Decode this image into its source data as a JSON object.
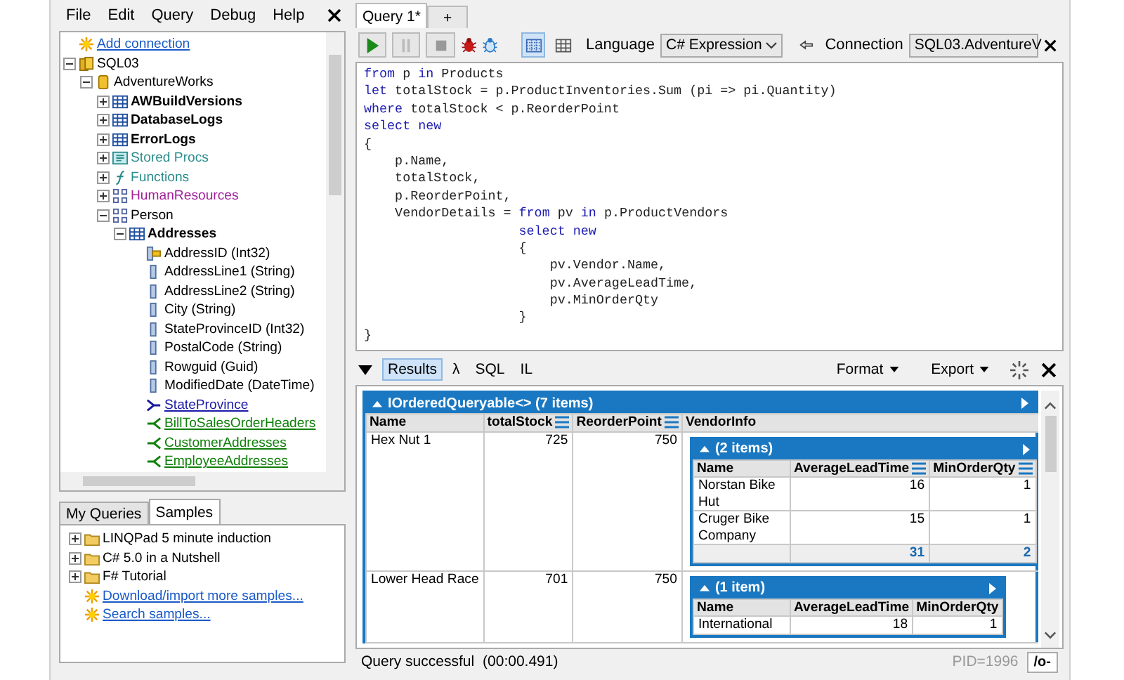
{
  "menu": [
    "File",
    "Edit",
    "Query",
    "Debug",
    "Help"
  ],
  "schema_tree": [
    {
      "kind": "add",
      "label": "Add connection"
    },
    {
      "kind": "server",
      "label": "SQL03",
      "expanded": true,
      "children": [
        {
          "kind": "database",
          "label": "AdventureWorks",
          "expanded": true,
          "children": [
            {
              "kind": "table",
              "label": "AWBuildVersions",
              "expanded": false
            },
            {
              "kind": "table",
              "label": "DatabaseLogs",
              "expanded": false
            },
            {
              "kind": "table",
              "label": "ErrorLogs",
              "expanded": false
            },
            {
              "kind": "sp",
              "label": "Stored Procs",
              "expanded": false,
              "color": "#2a8c8c"
            },
            {
              "kind": "fx",
              "label": "Functions",
              "expanded": false,
              "color": "#2a8c8c"
            },
            {
              "kind": "schema",
              "label": "HumanResources",
              "expanded": false,
              "color": "#a0209a"
            },
            {
              "kind": "schema",
              "label": "Person",
              "expanded": true,
              "children": [
                {
                  "kind": "table",
                  "label": "Addresses",
                  "expanded": true,
                  "children": [
                    {
                      "kind": "key-column",
                      "label": "AddressID (Int32)"
                    },
                    {
                      "kind": "column",
                      "label": "AddressLine1 (String)"
                    },
                    {
                      "kind": "column",
                      "label": "AddressLine2 (String)"
                    },
                    {
                      "kind": "column",
                      "label": "City (String)"
                    },
                    {
                      "kind": "column",
                      "label": "StateProvinceID (Int32)"
                    },
                    {
                      "kind": "column",
                      "label": "PostalCode (String)"
                    },
                    {
                      "kind": "column",
                      "label": "Rowguid (Guid)"
                    },
                    {
                      "kind": "column",
                      "label": "ModifiedDate (DateTime)"
                    },
                    {
                      "kind": "parent-rel",
                      "label": "StateProvince"
                    },
                    {
                      "kind": "child-rel",
                      "label": "BillToSalesOrderHeaders"
                    },
                    {
                      "kind": "child-rel",
                      "label": "CustomerAddresses"
                    },
                    {
                      "kind": "child-rel",
                      "label": "EmployeeAddresses"
                    }
                  ]
                }
              ]
            }
          ]
        }
      ]
    }
  ],
  "explorer_tabs": [
    {
      "label": "My Queries",
      "selected": false
    },
    {
      "label": "Samples",
      "selected": true
    }
  ],
  "samples_tree": [
    {
      "kind": "folder",
      "label": "LINQPad 5 minute induction",
      "expanded": false
    },
    {
      "kind": "folder",
      "label": "C# 5.0 in a Nutshell",
      "expanded": false
    },
    {
      "kind": "folder",
      "label": "F# Tutorial",
      "expanded": false
    },
    {
      "kind": "add",
      "label": "Download/import more samples..."
    },
    {
      "kind": "add",
      "label": "Search samples..."
    }
  ],
  "query_tabs": [
    {
      "label": "Query 1*",
      "selected": true
    },
    {
      "label": "+",
      "selected": false
    }
  ],
  "toolbar": {
    "view_modes": [
      {
        "kind": "rich",
        "selected": true
      },
      {
        "kind": "grid",
        "selected": false
      }
    ],
    "language": {
      "label": "Language",
      "value": "C# Expression"
    },
    "connection": {
      "label": "Connection",
      "value": "SQL03.AdventureV"
    }
  },
  "code_lines": [
    [
      {
        "kind": "keyword",
        "text": "from"
      },
      {
        "kind": "plain",
        "text": " p "
      },
      {
        "kind": "keyword",
        "text": "in"
      },
      {
        "kind": "plain",
        "text": " Products"
      }
    ],
    [
      {
        "kind": "keyword",
        "text": "let"
      },
      {
        "kind": "plain",
        "text": " totalStock = p.ProductInventories.Sum (pi => pi.Quantity)"
      }
    ],
    [
      {
        "kind": "keyword",
        "text": "where"
      },
      {
        "kind": "plain",
        "text": " totalStock < p.ReorderPoint"
      }
    ],
    [
      {
        "kind": "keyword",
        "text": "select"
      },
      {
        "kind": "keyword",
        "text": " new"
      }
    ],
    [
      {
        "kind": "plain",
        "text": "{"
      }
    ],
    [
      {
        "kind": "plain",
        "text": "    p.Name,"
      }
    ],
    [
      {
        "kind": "plain",
        "text": "    totalStock,"
      }
    ],
    [
      {
        "kind": "plain",
        "text": "    p.ReorderPoint,"
      }
    ],
    [
      {
        "kind": "plain",
        "text": "    VendorDetails = "
      },
      {
        "kind": "keyword",
        "text": "from"
      },
      {
        "kind": "plain",
        "text": " pv "
      },
      {
        "kind": "keyword",
        "text": "in"
      },
      {
        "kind": "plain",
        "text": " p.ProductVendors"
      }
    ],
    [
      {
        "kind": "keyword",
        "text": "                    select"
      },
      {
        "kind": "keyword",
        "text": " new"
      }
    ],
    [
      {
        "kind": "plain",
        "text": "                    {"
      }
    ],
    [
      {
        "kind": "plain",
        "text": "                        pv.Vendor.Name,"
      }
    ],
    [
      {
        "kind": "plain",
        "text": "                        pv.AverageLeadTime,"
      }
    ],
    [
      {
        "kind": "plain",
        "text": "                        pv.MinOrderQty"
      }
    ],
    [
      {
        "kind": "plain",
        "text": "                    }"
      }
    ],
    [
      {
        "kind": "plain",
        "text": "}"
      }
    ]
  ],
  "results": {
    "tabs": [
      {
        "label": "Results",
        "selected": true
      },
      {
        "label": "λ",
        "selected": false
      },
      {
        "label": "SQL",
        "selected": false
      },
      {
        "label": "IL",
        "selected": false
      }
    ],
    "menus": [
      "Format",
      "Export"
    ],
    "grid": {
      "title": "IOrderedQueryable<> (7 items)",
      "columns": [
        {
          "label": "Name",
          "kind": "text"
        },
        {
          "label": "totalStock",
          "kind": "numeric"
        },
        {
          "label": "ReorderPoint",
          "kind": "numeric"
        },
        {
          "label": "VendorInfo",
          "kind": "nested"
        }
      ],
      "rows": [
        [
          "Hex Nut 1",
          "725",
          "750",
          {
            "title": "(2 items)",
            "columns": [
              {
                "label": "Name",
                "kind": "text"
              },
              {
                "label": "AverageLeadTime",
                "kind": "numeric"
              },
              {
                "label": "MinOrderQty",
                "kind": "numeric"
              }
            ],
            "rows": [
              [
                "Norstan Bike Hut",
                "16",
                "1"
              ],
              [
                "Cruger Bike Company",
                "15",
                "1"
              ]
            ],
            "totals": [
              "31",
              "2"
            ]
          }
        ],
        [
          "Lower Head Race",
          "701",
          "750",
          {
            "title": "(1 item)",
            "columns": [
              {
                "label": "Name",
                "kind": "text"
              },
              {
                "label": "AverageLeadTime",
                "kind": "plain"
              },
              {
                "label": "MinOrderQty",
                "kind": "plain"
              }
            ],
            "rows": [
              [
                "International",
                "18",
                "1"
              ]
            ]
          }
        ]
      ]
    }
  },
  "status_bar": {
    "message": "Query successful",
    "elapsed": "(00:00.491)",
    "pid": "PID=1996",
    "toggle": "/o-"
  }
}
